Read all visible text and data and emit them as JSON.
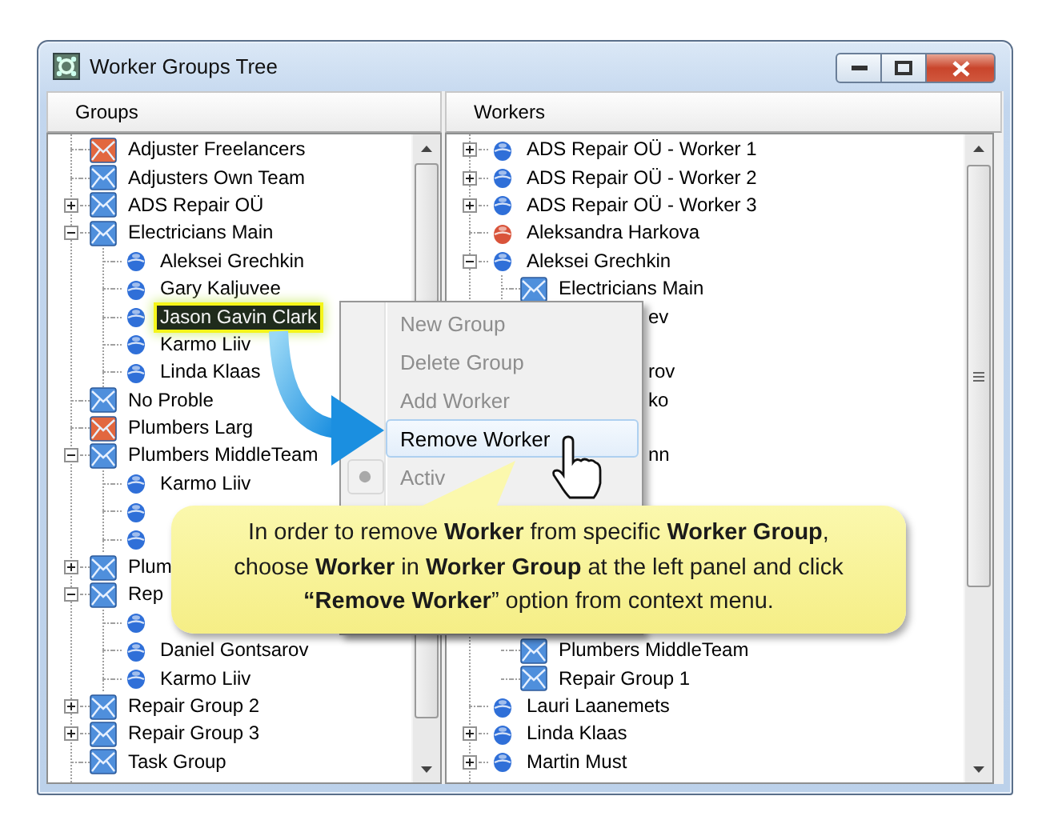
{
  "window": {
    "title": "Worker Groups Tree"
  },
  "groups_panel": {
    "header": "Groups",
    "tree": [
      {
        "kind": "group",
        "label": "Adjuster Freelancers",
        "color": "#e2673f",
        "selected": false
      },
      {
        "kind": "group",
        "label": "Adjusters Own Team",
        "color": "#4f8fdc",
        "selected": false
      },
      {
        "kind": "group",
        "label": "ADS Repair OÜ",
        "color": "#4f8fdc",
        "expanded": false,
        "selected": false
      },
      {
        "kind": "group",
        "label": "Electricians Main",
        "color": "#4f8fdc",
        "expanded": true,
        "selected": false,
        "children": [
          {
            "kind": "worker",
            "label": "Aleksei Grechkin",
            "color": "#2f6fd8",
            "selected": false
          },
          {
            "kind": "worker",
            "label": "Gary Kaljuvee",
            "color": "#2f6fd8",
            "selected": false
          },
          {
            "kind": "worker",
            "label": "Jason Gavin Clark",
            "color": "#2f6fd8",
            "selected": true
          },
          {
            "kind": "worker",
            "label": "Karmo Liiv",
            "color": "#2f6fd8",
            "selected": false
          },
          {
            "kind": "worker",
            "label": "Linda Klaas",
            "color": "#2f6fd8",
            "selected": false
          }
        ]
      },
      {
        "kind": "group",
        "label": "No Proble",
        "color": "#4f8fdc",
        "selected": false
      },
      {
        "kind": "group",
        "label": "Plumbers Larg",
        "color": "#e2673f",
        "selected": false
      },
      {
        "kind": "group",
        "label": "Plumbers MiddleTeam",
        "color": "#4f8fdc",
        "expanded": true,
        "selected": false,
        "children": [
          {
            "kind": "worker",
            "label": "Karmo Liiv",
            "color": "#2f6fd8",
            "selected": false
          },
          {
            "kind": "worker",
            "color": "#2f6fd8",
            "selected": false
          },
          {
            "kind": "worker",
            "color": "#2f6fd8",
            "selected": false
          }
        ]
      },
      {
        "kind": "group",
        "label": "Plum",
        "color": "#4f8fdc",
        "expanded": false,
        "selected": false
      },
      {
        "kind": "group",
        "label": "Rep",
        "color": "#4f8fdc",
        "expanded": true,
        "selected": false,
        "children": [
          {
            "kind": "worker",
            "color": "#2f6fd8",
            "selected": false
          },
          {
            "kind": "worker",
            "label": "Daniel Gontsarov",
            "color": "#2f6fd8",
            "selected": false
          },
          {
            "kind": "worker",
            "label": "Karmo Liiv",
            "color": "#2f6fd8",
            "selected": false
          }
        ]
      },
      {
        "kind": "group",
        "label": "Repair Group 2",
        "color": "#4f8fdc",
        "expanded": false,
        "selected": false
      },
      {
        "kind": "group",
        "label": "Repair Group 3",
        "color": "#4f8fdc",
        "expanded": false,
        "selected": false
      },
      {
        "kind": "group",
        "label": "Task Group",
        "color": "#4f8fdc",
        "selected": false
      }
    ]
  },
  "workers_panel": {
    "header": "Workers",
    "tree": [
      {
        "kind": "worker",
        "label": "ADS Repair OÜ - Worker 1",
        "color": "#2f6fd8",
        "expanded": false
      },
      {
        "kind": "worker",
        "label": "ADS Repair OÜ - Worker 2",
        "color": "#2f6fd8",
        "expanded": false
      },
      {
        "kind": "worker",
        "label": "ADS Repair OÜ - Worker 3",
        "color": "#2f6fd8",
        "expanded": false
      },
      {
        "kind": "worker",
        "label": "Aleksandra Harkova",
        "color": "#d9533a"
      },
      {
        "kind": "worker",
        "label": "Aleksei Grechkin",
        "color": "#2f6fd8",
        "expanded": true,
        "children": [
          {
            "kind": "group",
            "label": "Electricians Main",
            "color": "#4f8fdc"
          }
        ]
      },
      {
        "kind": "partial",
        "label": "ev"
      },
      {
        "kind": "covered"
      },
      {
        "kind": "partial",
        "label": "rov"
      },
      {
        "kind": "partial",
        "label": "ko"
      },
      {
        "kind": "covered"
      },
      {
        "kind": "partial",
        "label": "nn"
      },
      {
        "kind": "covered"
      },
      {
        "kind": "covered"
      },
      {
        "kind": "covered"
      },
      {
        "kind": "covered"
      },
      {
        "kind": "covered"
      },
      {
        "kind": "covered",
        "children": [
          {
            "kind": "group",
            "label": "Plumbers MiddleTeam",
            "color": "#4f8fdc"
          },
          {
            "kind": "group",
            "label": "Repair Group 1",
            "color": "#4f8fdc"
          }
        ]
      },
      {
        "kind": "worker",
        "label": "Lauri Laanemets",
        "color": "#2f6fd8"
      },
      {
        "kind": "worker",
        "label": "Linda Klaas",
        "color": "#2f6fd8",
        "expanded": false
      },
      {
        "kind": "worker",
        "label": "Martin Must",
        "color": "#2f6fd8",
        "expanded": false
      }
    ]
  },
  "context_menu": {
    "items": [
      {
        "kind": "item",
        "label": "New Group",
        "disabled": true,
        "highlighted": false
      },
      {
        "kind": "item",
        "label": "Delete Group",
        "disabled": true,
        "highlighted": false
      },
      {
        "kind": "item",
        "label": "Add Worker",
        "disabled": true,
        "highlighted": false
      },
      {
        "kind": "item",
        "label": "Remove Worker",
        "disabled": false,
        "highlighted": true
      },
      {
        "kind": "radio",
        "label": "Activ",
        "disabled": true,
        "highlighted": false,
        "checked": true
      }
    ]
  },
  "callout": {
    "text": "In order to remove **Worker** from specific **Worker Group**, choose **Worker** in **Worker Group** at the left panel and click **“Remove Worker**” option from context menu."
  }
}
